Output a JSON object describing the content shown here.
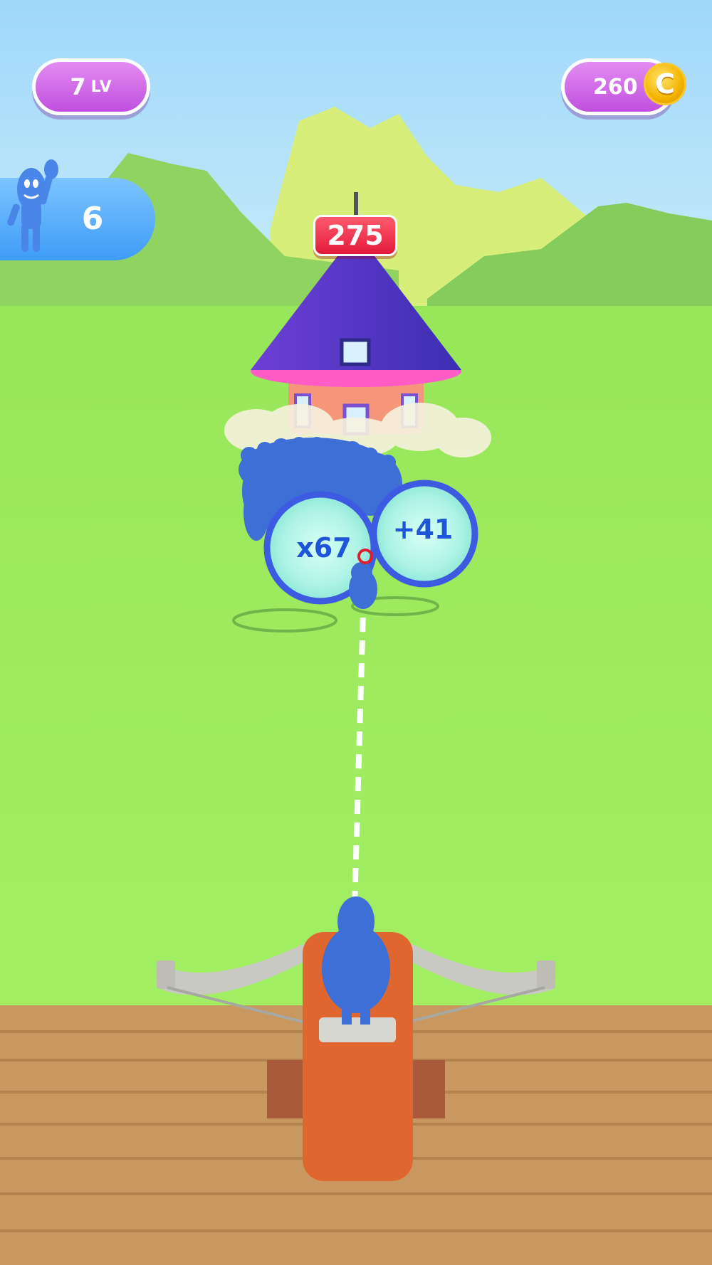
{
  "hud": {
    "level": {
      "value": "7",
      "unit": "LV"
    },
    "coins": {
      "value": "260",
      "icon": "coin-icon",
      "icon_glyph": "C"
    },
    "crowd": {
      "count": "6",
      "icon": "mascot-icon"
    }
  },
  "tower": {
    "hp": "275"
  },
  "gates": [
    {
      "label": "x67",
      "type": "multiply"
    },
    {
      "label": "+41",
      "type": "add"
    }
  ],
  "colors": {
    "sky": "#a8dcfb",
    "grass": "#9bea5a",
    "deck": "#c99a62",
    "unit_blue": "#3d6fd6",
    "hud_purple": "#c95ce6",
    "hp_red": "#e8213f",
    "coin_gold": "#f5b700"
  }
}
